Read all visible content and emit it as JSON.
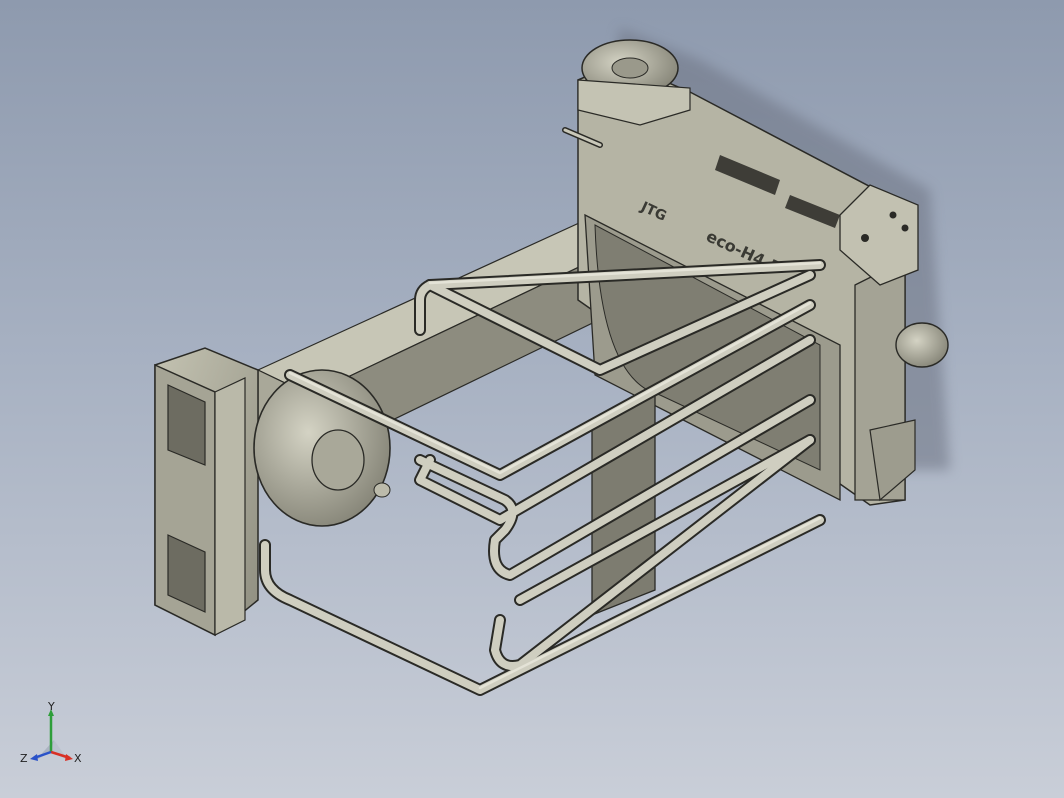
{
  "viewport": {
    "background_top": "#8e9aae",
    "background_bottom": "#c9ced8",
    "model_color": "#b9b8a6",
    "model_shadow": "#6b6a5e",
    "edge_color": "#2a2a26"
  },
  "model": {
    "engraving_brand": "JTG",
    "engraving_model": "eco-H4.5"
  },
  "triad": {
    "x_label": "X",
    "y_label": "Y",
    "z_label": "Z",
    "x_color": "#d93025",
    "y_color": "#2e9e3a",
    "z_color": "#2a52c9"
  }
}
